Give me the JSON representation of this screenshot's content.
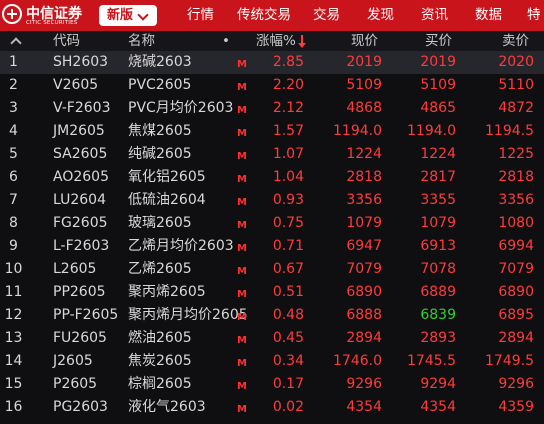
{
  "brand": {
    "name_cn": "中信证券",
    "name_en": "CITIC SECURITIES"
  },
  "version_button": "新版",
  "nav": [
    "行情",
    "传统交易",
    "交易",
    "发现",
    "资讯",
    "数据",
    "特"
  ],
  "columns": {
    "code": "代码",
    "name": "名称",
    "dot": "•",
    "change": "涨幅%",
    "price": "现价",
    "bid": "买价",
    "ask": "卖价"
  },
  "sort": {
    "column": "change",
    "direction": "descending"
  },
  "colors": {
    "up": "#ff3b3b",
    "down": "#2fd12f",
    "brand": "#c8141a"
  },
  "rows": [
    {
      "idx": "1",
      "code": "SH2603",
      "name": "烧碱2603",
      "marker": "M",
      "change": "2.85",
      "price": "2019",
      "bid": "2019",
      "ask": "2020"
    },
    {
      "idx": "2",
      "code": "V2605",
      "name": "PVC2605",
      "marker": "M",
      "change": "2.20",
      "price": "5109",
      "bid": "5109",
      "ask": "5110"
    },
    {
      "idx": "3",
      "code": "V-F2603",
      "name": "PVC月均价2603",
      "marker": "M",
      "change": "2.12",
      "price": "4868",
      "bid": "4865",
      "ask": "4872"
    },
    {
      "idx": "4",
      "code": "JM2605",
      "name": "焦煤2605",
      "marker": "M",
      "change": "1.57",
      "price": "1194.0",
      "bid": "1194.0",
      "ask": "1194.5"
    },
    {
      "idx": "5",
      "code": "SA2605",
      "name": "纯碱2605",
      "marker": "M",
      "change": "1.07",
      "price": "1224",
      "bid": "1224",
      "ask": "1225"
    },
    {
      "idx": "6",
      "code": "AO2605",
      "name": "氧化铝2605",
      "marker": "M",
      "change": "1.04",
      "price": "2818",
      "bid": "2817",
      "ask": "2818"
    },
    {
      "idx": "7",
      "code": "LU2604",
      "name": "低硫油2604",
      "marker": "M",
      "change": "0.93",
      "price": "3356",
      "bid": "3355",
      "ask": "3356"
    },
    {
      "idx": "8",
      "code": "FG2605",
      "name": "玻璃2605",
      "marker": "M",
      "change": "0.75",
      "price": "1079",
      "bid": "1079",
      "ask": "1080"
    },
    {
      "idx": "9",
      "code": "L-F2603",
      "name": "乙烯月均价2603",
      "marker": "M",
      "change": "0.71",
      "price": "6947",
      "bid": "6913",
      "ask": "6994"
    },
    {
      "idx": "10",
      "code": "L2605",
      "name": "乙烯2605",
      "marker": "M",
      "change": "0.67",
      "price": "7079",
      "bid": "7078",
      "ask": "7079"
    },
    {
      "idx": "11",
      "code": "PP2605",
      "name": "聚丙烯2605",
      "marker": "M",
      "change": "0.51",
      "price": "6890",
      "bid": "6889",
      "ask": "6890"
    },
    {
      "idx": "12",
      "code": "PP-F2605",
      "name": "聚丙烯月均价2605",
      "marker": "M",
      "change": "0.48",
      "price": "6888",
      "bid": "6839",
      "ask": "6895",
      "bid_down": true
    },
    {
      "idx": "13",
      "code": "FU2605",
      "name": "燃油2605",
      "marker": "M",
      "change": "0.45",
      "price": "2894",
      "bid": "2893",
      "ask": "2894"
    },
    {
      "idx": "14",
      "code": "J2605",
      "name": "焦炭2605",
      "marker": "M",
      "change": "0.34",
      "price": "1746.0",
      "bid": "1745.5",
      "ask": "1749.5"
    },
    {
      "idx": "15",
      "code": "P2605",
      "name": "棕榈2605",
      "marker": "M",
      "change": "0.17",
      "price": "9296",
      "bid": "9294",
      "ask": "9296"
    },
    {
      "idx": "16",
      "code": "PG2603",
      "name": "液化气2603",
      "marker": "M",
      "change": "0.02",
      "price": "4354",
      "bid": "4354",
      "ask": "4359"
    }
  ]
}
